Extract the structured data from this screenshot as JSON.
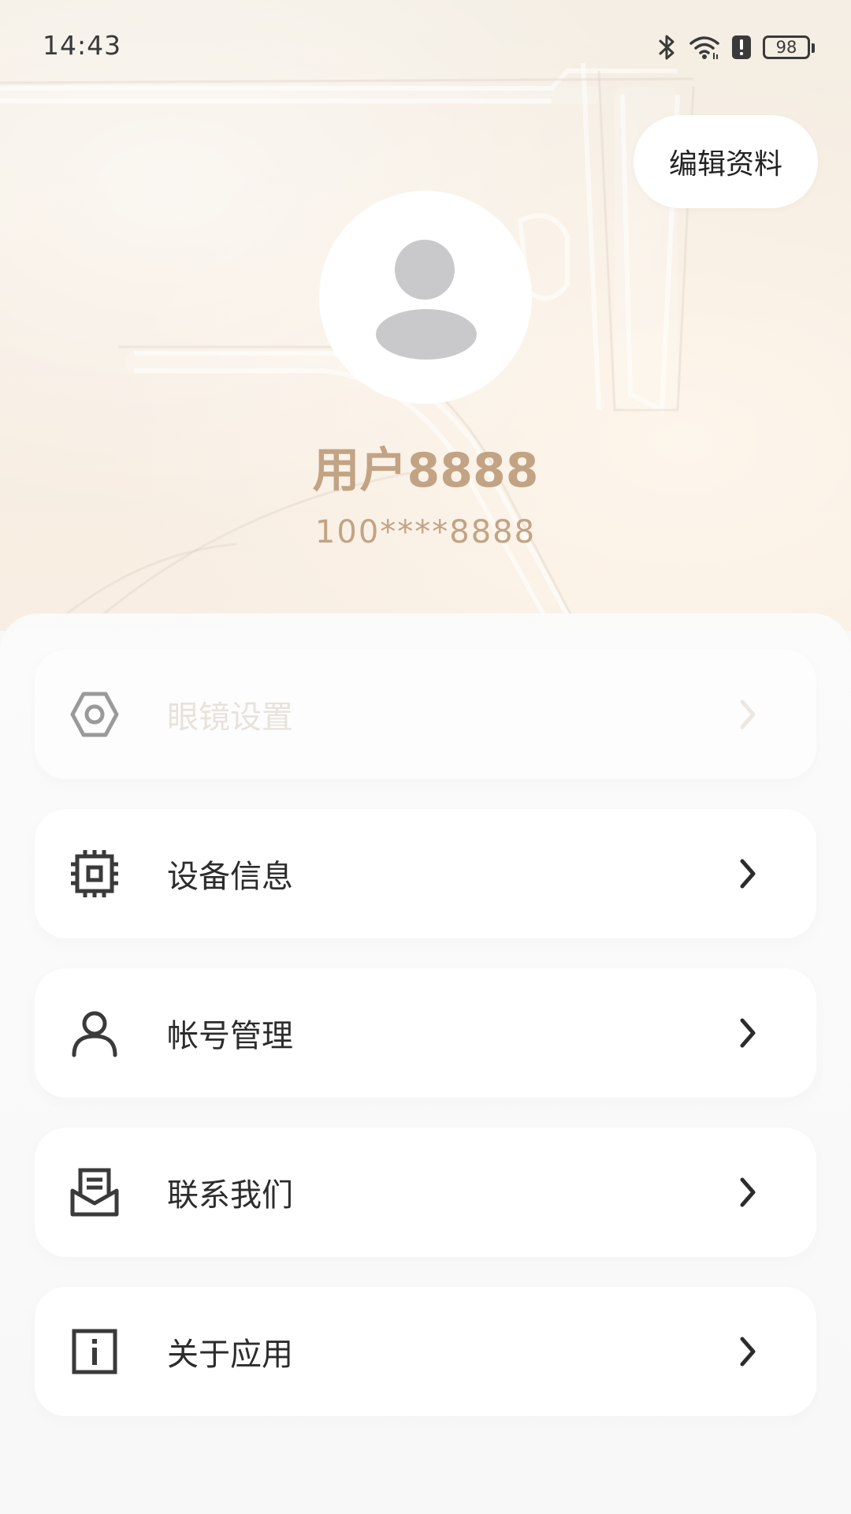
{
  "status_bar": {
    "time": "14:43",
    "battery": "98",
    "icons": [
      "bluetooth-icon",
      "wifi-icon",
      "alert-icon",
      "battery-icon"
    ]
  },
  "profile": {
    "edit_label": "编辑资料",
    "username": "用户8888",
    "user_id": "100****8888"
  },
  "menu": {
    "items": [
      {
        "label": "眼镜设置",
        "icon": "hexagon-nut-icon",
        "disabled": true
      },
      {
        "label": "设备信息",
        "icon": "chip-icon",
        "disabled": false
      },
      {
        "label": "帐号管理",
        "icon": "user-icon",
        "disabled": false
      },
      {
        "label": "联系我们",
        "icon": "inbox-icon",
        "disabled": false
      },
      {
        "label": "关于应用",
        "icon": "info-icon",
        "disabled": false
      }
    ]
  },
  "colors": {
    "accent_text": "#c2a384",
    "label_text": "#2c2c2c",
    "disabled_text": "#e8e2dc",
    "icon_dark": "#3a3a3a",
    "avatar_gray": "#c9c9cc"
  }
}
